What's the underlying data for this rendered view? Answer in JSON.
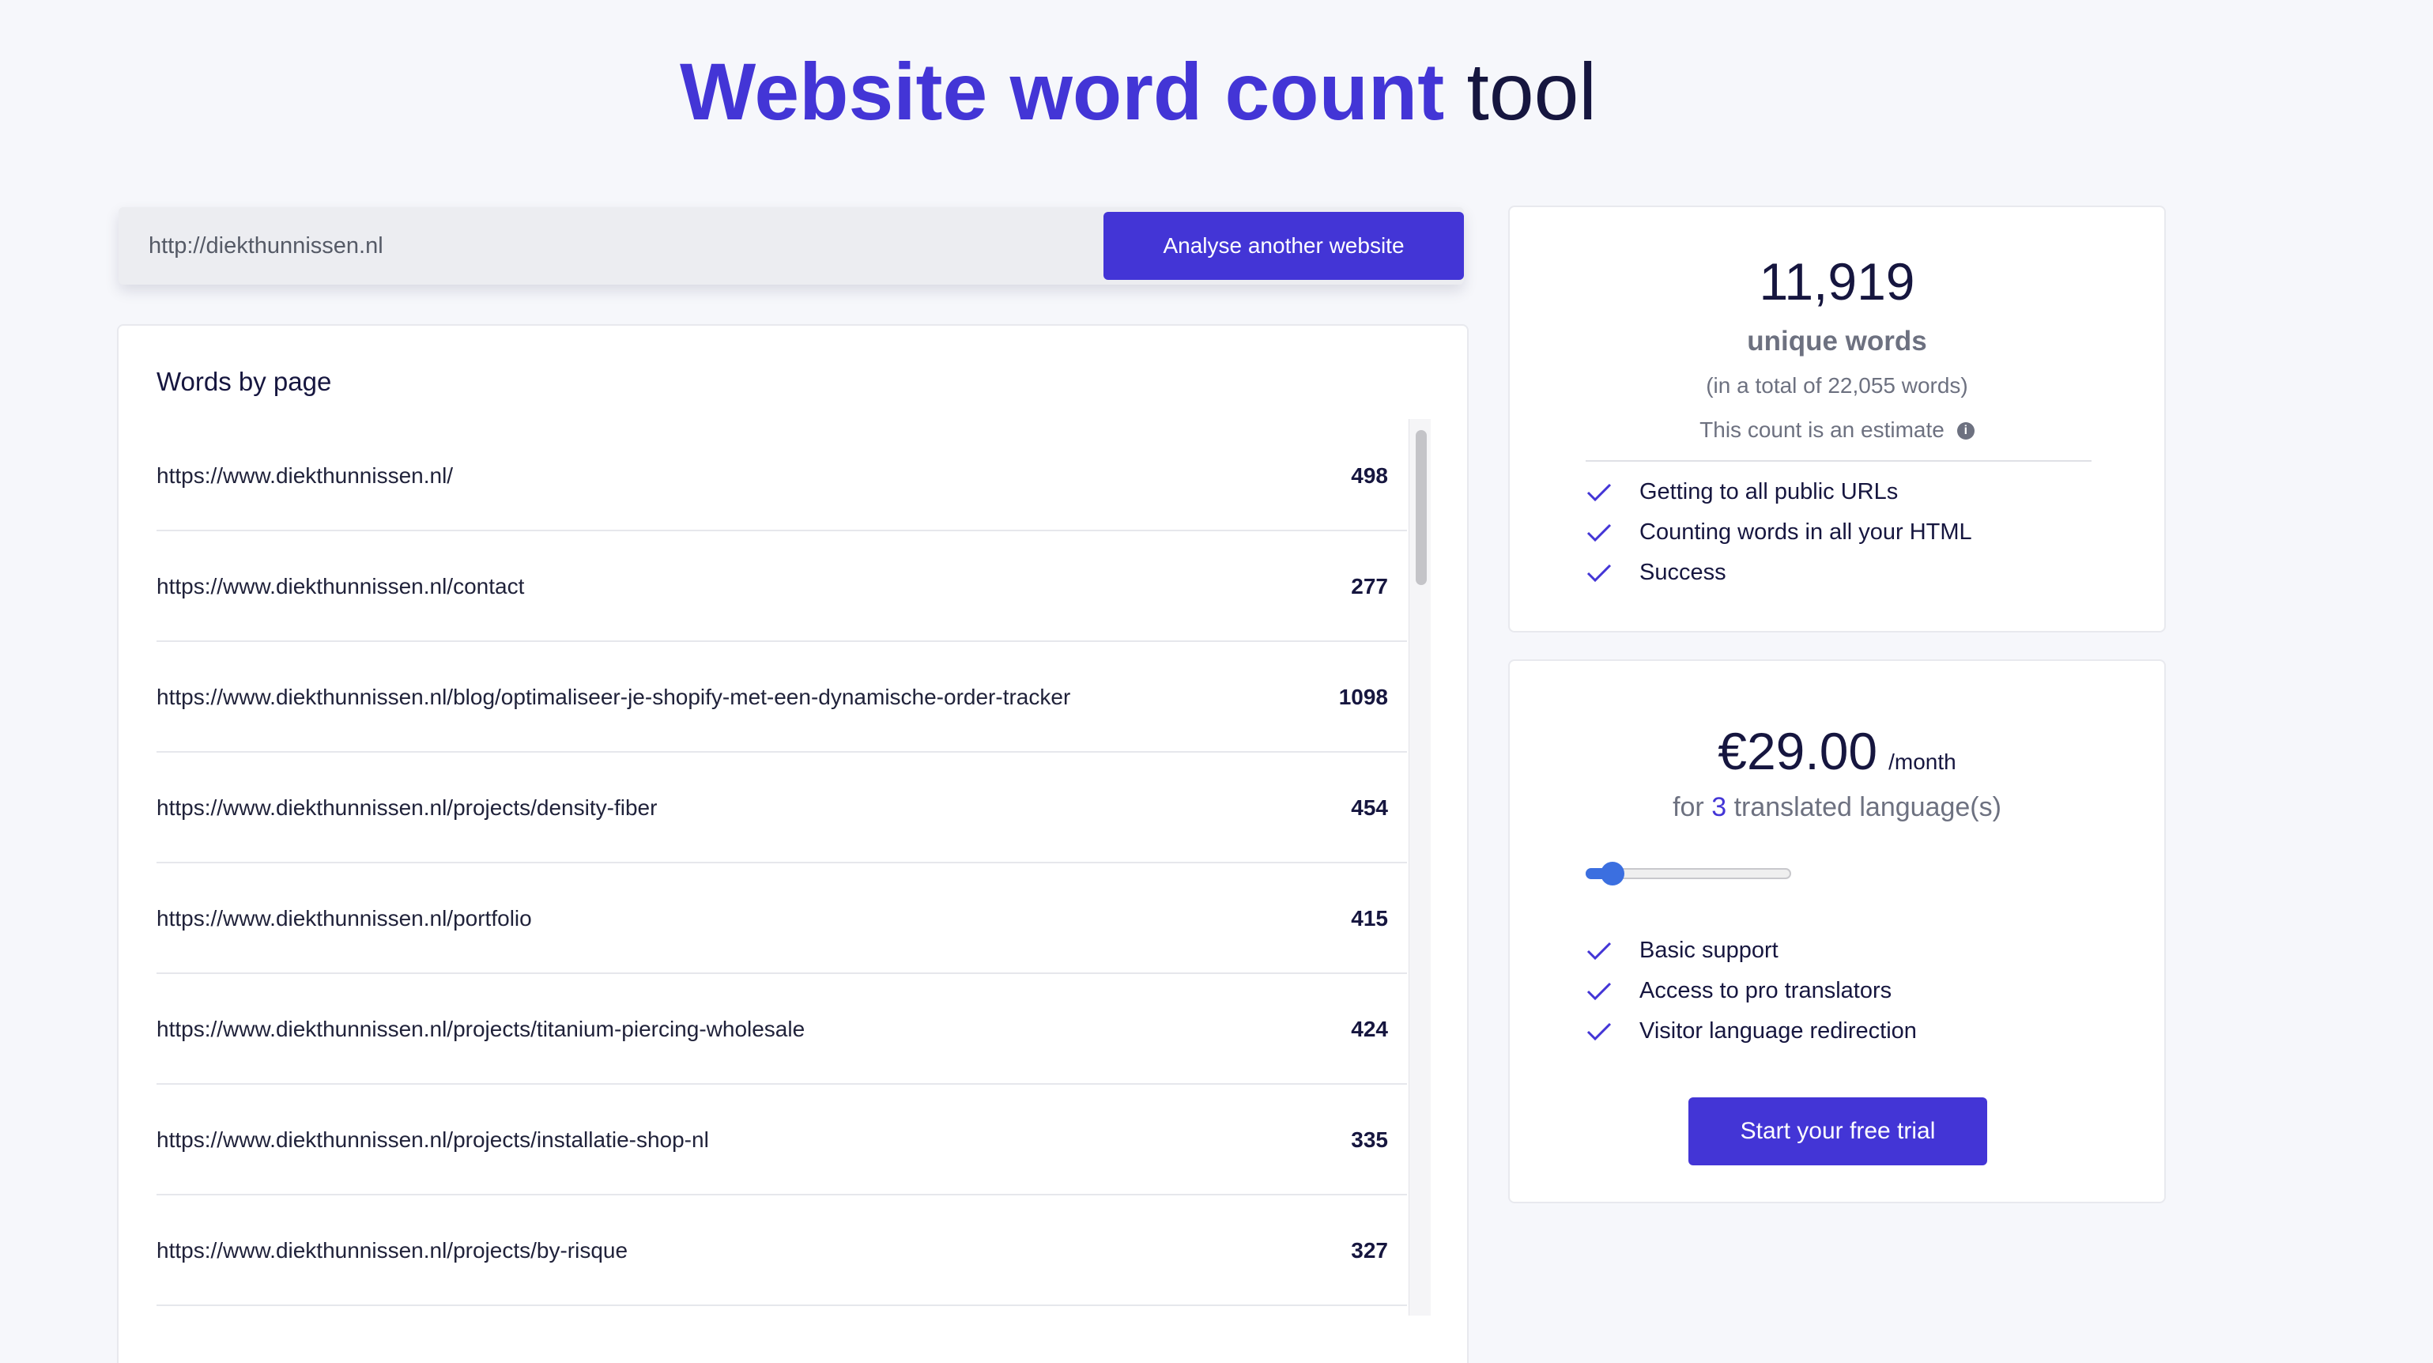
{
  "header": {
    "title_accent": "Website word count",
    "title_rest": "tool"
  },
  "search": {
    "value": "http://diekthunnissen.nl",
    "button_label": "Analyse another website"
  },
  "words_by_page": {
    "title": "Words by page",
    "rows": [
      {
        "url": "https://www.diekthunnissen.nl/",
        "count": "498"
      },
      {
        "url": "https://www.diekthunnissen.nl/contact",
        "count": "277"
      },
      {
        "url": "https://www.diekthunnissen.nl/blog/optimaliseer-je-shopify-met-een-dynamische-order-tracker",
        "count": "1098"
      },
      {
        "url": "https://www.diekthunnissen.nl/projects/density-fiber",
        "count": "454"
      },
      {
        "url": "https://www.diekthunnissen.nl/portfolio",
        "count": "415"
      },
      {
        "url": "https://www.diekthunnissen.nl/projects/titanium-piercing-wholesale",
        "count": "424"
      },
      {
        "url": "https://www.diekthunnissen.nl/projects/installatie-shop-nl",
        "count": "335"
      },
      {
        "url": "https://www.diekthunnissen.nl/projects/by-risque",
        "count": "327"
      }
    ]
  },
  "stats": {
    "unique_count": "11,919",
    "unique_label": "unique words",
    "total_text": "(in a total of 22,055 words)",
    "estimate_text": "This count is an estimate",
    "info_icon": "i",
    "checks": [
      "Getting to all public URLs",
      "Counting words in all your HTML",
      "Success"
    ]
  },
  "pricing": {
    "price": "€29.00",
    "period": "/month",
    "for_prefix": "for",
    "language_count": "3",
    "for_suffix": "translated language(s)",
    "slider_fraction": 0.13,
    "features": [
      "Basic support",
      "Access to pro translators",
      "Visitor language redirection"
    ],
    "cta_label": "Start your free trial"
  },
  "colors": {
    "accent": "#4335d6",
    "slider": "#3b6fe0"
  }
}
